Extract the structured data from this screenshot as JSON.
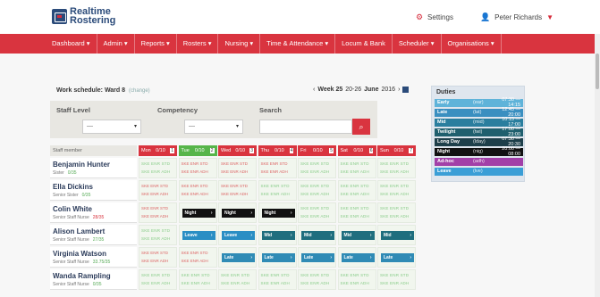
{
  "brand": {
    "line1": "Realtime",
    "line2": "Rostering"
  },
  "topbar": {
    "settings_label": "Settings",
    "user_name": "Peter Richards"
  },
  "nav": [
    "Dashboard ▾",
    "Admin ▾",
    "Reports ▾",
    "Rosters ▾",
    "Nursing ▾",
    "Time & Attendance ▾",
    "Locum & Bank",
    "Scheduler ▾",
    "Organisations ▾"
  ],
  "schedule": {
    "title": "Work schedule: Ward 8",
    "change_link": "(change)",
    "week_prev": "‹",
    "week_label": "Week 25",
    "week_range": "20-26",
    "week_month": "June",
    "week_year": "2016",
    "week_next": "›"
  },
  "filters": {
    "staff_level_label": "Staff Level",
    "competency_label": "Competency",
    "search_label": "Search",
    "staff_level_value": "—",
    "competency_value": "—",
    "search_placeholder": ""
  },
  "duties": {
    "title": "Duties",
    "items": [
      {
        "name": "Early",
        "code": "(ear)",
        "time": "07:30 — 14:15",
        "color": "#5fb3d9"
      },
      {
        "name": "Late",
        "code": "(lat)",
        "time": "12:45 — 20:00",
        "color": "#3a8fc0"
      },
      {
        "name": "Mid",
        "code": "(mid)",
        "time": "10:15 — 17:00",
        "color": "#2a7e9e"
      },
      {
        "name": "Twilight",
        "code": "(twi)",
        "time": "17:00 — 23:00",
        "color": "#1f5f6e"
      },
      {
        "name": "Long Day",
        "code": "(lday)",
        "time": "07:30 — 20:30",
        "color": "#1d3f4a"
      },
      {
        "name": "Night",
        "code": "(nig)",
        "time": "20:00 — 08:00",
        "color": "#111111"
      },
      {
        "name": "Ad-hoc",
        "code": "(adh)",
        "time": "",
        "color": "#a23fa8"
      },
      {
        "name": "Leave",
        "code": "(lve)",
        "time": "",
        "color": "#3a9ed6"
      }
    ]
  },
  "grid": {
    "staff_header": "Staff member",
    "days": [
      {
        "label": "Mon",
        "date": "0/10",
        "num": "1",
        "color": "#d9343f"
      },
      {
        "label": "Tue",
        "date": "0/10",
        "num": "2",
        "color": "#56b54a"
      },
      {
        "label": "Wed",
        "date": "0/10",
        "num": "3",
        "color": "#d9343f"
      },
      {
        "label": "Thu",
        "date": "0/10",
        "num": "4",
        "color": "#d9343f"
      },
      {
        "label": "Fri",
        "date": "0/10",
        "num": "5",
        "color": "#d9343f"
      },
      {
        "label": "Sat",
        "date": "0/10",
        "num": "6",
        "color": "#d9343f"
      },
      {
        "label": "Sun",
        "date": "0/10",
        "num": "7",
        "color": "#d9343f"
      }
    ],
    "staff": [
      {
        "name": "Benjamin Hunter",
        "role": "Sister",
        "hours": "0/35",
        "hours_red": false
      },
      {
        "name": "Ella Dickins",
        "role": "Senior Sister",
        "hours": "0/35",
        "hours_red": false
      },
      {
        "name": "Colin White",
        "role": "Senior Staff Nurse",
        "hours": "28/35",
        "hours_red": true
      },
      {
        "name": "Alison Lambert",
        "role": "Senior Staff Nurse",
        "hours": "27/35",
        "hours_red": false
      },
      {
        "name": "Virginia Watson",
        "role": "Senior Staff Nurse",
        "hours": "33.75/35",
        "hours_red": false
      },
      {
        "name": "Wanda Rampling",
        "role": "Senior Staff Nurse",
        "hours": "0/35",
        "hours_red": false
      }
    ],
    "shift_label_night": "Night",
    "shift_label_leave": "Leave",
    "shift_label_mid": "Mid",
    "shift_label_late": "Late",
    "shift_arrow": "›"
  }
}
